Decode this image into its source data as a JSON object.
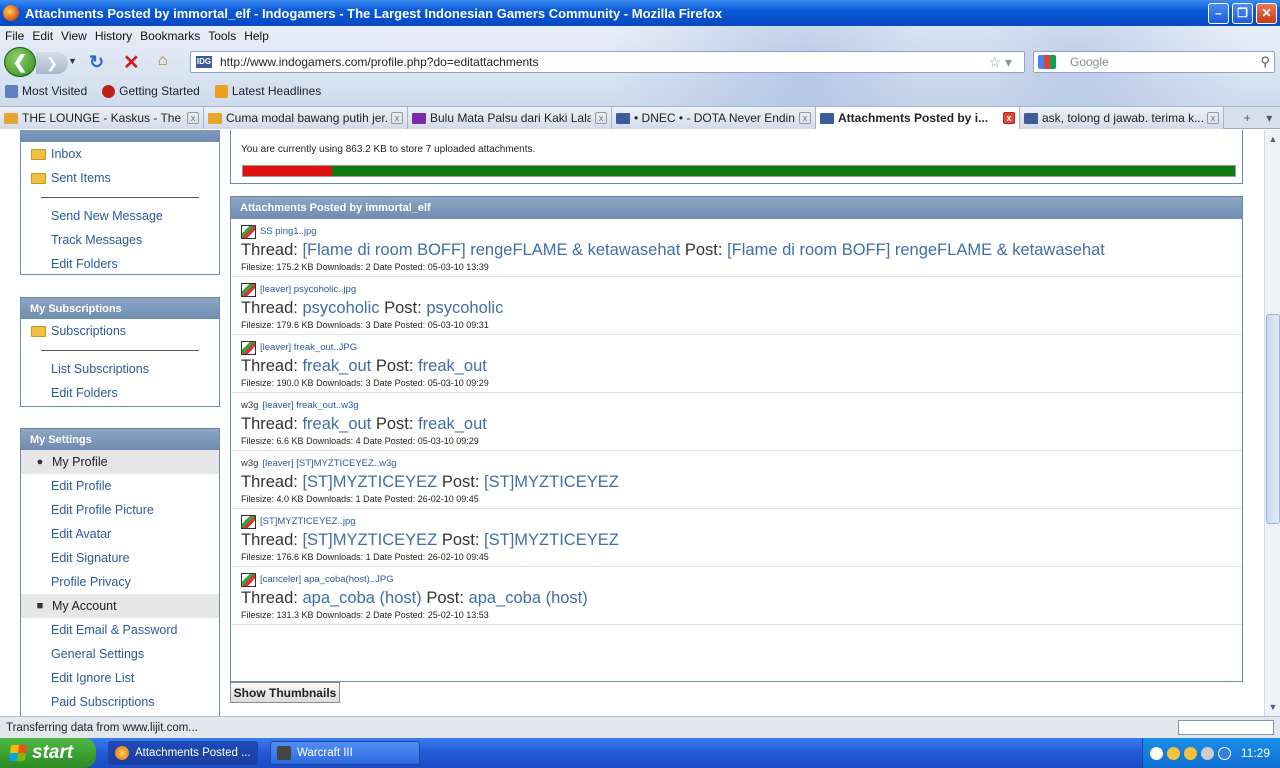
{
  "window": {
    "title": "Attachments Posted by immortal_elf - Indogamers - The Largest Indonesian Gamers Community - Mozilla Firefox"
  },
  "menu": [
    "File",
    "Edit",
    "View",
    "History",
    "Bookmarks",
    "Tools",
    "Help"
  ],
  "nav": {
    "url": "http://www.indogamers.com/profile.php?do=editattachments",
    "fav": "IDG",
    "search_placeholder": "Google"
  },
  "bookmarks": [
    "Most Visited",
    "Getting Started",
    "Latest Headlines"
  ],
  "tabs": [
    {
      "label": "THE LOUNGE - Kaskus - The L...",
      "active": false
    },
    {
      "label": "Cuma modal bawang putih jer...",
      "active": false
    },
    {
      "label": "Bulu Mata Palsu dari Kaki Lala...",
      "active": false
    },
    {
      "label": "• DNEC • - DOTA Never Endin...",
      "active": false
    },
    {
      "label": "Attachments Posted by i...",
      "active": true
    },
    {
      "label": "ask, tolong d jawab. terima k...",
      "active": false
    }
  ],
  "sidebar": {
    "messages": {
      "items": [
        "Inbox",
        "Sent Items"
      ],
      "links": [
        "Send New Message",
        "Track Messages",
        "Edit Folders"
      ]
    },
    "subscriptions": {
      "title": "My Subscriptions",
      "folder": "Subscriptions",
      "links": [
        "List Subscriptions",
        "Edit Folders"
      ]
    },
    "settings": {
      "title": "My Settings",
      "profile_group": "My Profile",
      "profile_links": [
        "Edit Profile",
        "Edit Profile Picture",
        "Edit Avatar",
        "Edit Signature",
        "Profile Privacy"
      ],
      "account_group": "My Account",
      "account_links": [
        "Edit Email & Password",
        "General Settings",
        "Edit Ignore List",
        "Paid Subscriptions"
      ]
    }
  },
  "usage": {
    "text": "You are currently using 863.2 KB to store 7 uploaded attachments.",
    "used_fraction": 0.09
  },
  "attachments": {
    "title": "Attachments Posted by immortal_elf",
    "labels": {
      "thread": "Thread:",
      "post": "Post:",
      "filesize": "Filesize:",
      "downloads": "Downloads:",
      "date": "Date Posted:"
    },
    "items": [
      {
        "ext": "",
        "file": "SS ping1..jpg",
        "thread": "[Flame di room BOFF] rengeFLAME & ketawasehat",
        "post": "[Flame di room BOFF] rengeFLAME & ketawasehat",
        "size": "175.2 KB",
        "downloads": "2",
        "date": "05-03-10 13:39"
      },
      {
        "ext": "",
        "file": "[leaver] psycoholic..jpg",
        "thread": "psycoholic",
        "post": "psycoholic",
        "size": "179.6 KB",
        "downloads": "3",
        "date": "05-03-10 09:31"
      },
      {
        "ext": "",
        "file": "[leaver] freak_out..JPG",
        "thread": "freak_out",
        "post": "freak_out",
        "size": "190.0 KB",
        "downloads": "3",
        "date": "05-03-10 09:29"
      },
      {
        "ext": "w3g",
        "file": "[leaver] freak_out..w3g",
        "thread": "freak_out",
        "post": "freak_out",
        "size": "6.6 KB",
        "downloads": "4",
        "date": "05-03-10 09:29"
      },
      {
        "ext": "w3g",
        "file": "[leaver] [ST]MYZTICEYEZ..w3g",
        "thread": "[ST]MYZTICEYEZ",
        "post": "[ST]MYZTICEYEZ",
        "size": "4.0 KB",
        "downloads": "1",
        "date": "26-02-10 09:45"
      },
      {
        "ext": "",
        "file": "[ST]MYZTICEYEZ..jpg",
        "thread": "[ST]MYZTICEYEZ",
        "post": "[ST]MYZTICEYEZ",
        "size": "176.6 KB",
        "downloads": "1",
        "date": "26-02-10 09:45"
      },
      {
        "ext": "",
        "file": "[canceler] apa_coba(host)..JPG",
        "thread": "apa_coba (host)",
        "post": "apa_coba (host)",
        "size": "131.3 KB",
        "downloads": "2",
        "date": "25-02-10 13:53"
      }
    ],
    "show_thumbnails": "Show Thumbnails"
  },
  "status": "Transferring data from www.lijit.com...",
  "taskbar": {
    "start": "start",
    "tasks": [
      "Attachments Posted ...",
      "Warcraft III"
    ],
    "clock": "11:29"
  },
  "colors": {
    "accent": "#6f8bb0",
    "link": "#2a5a9c",
    "usage_used": "#e01010",
    "usage_free": "#117a11"
  }
}
